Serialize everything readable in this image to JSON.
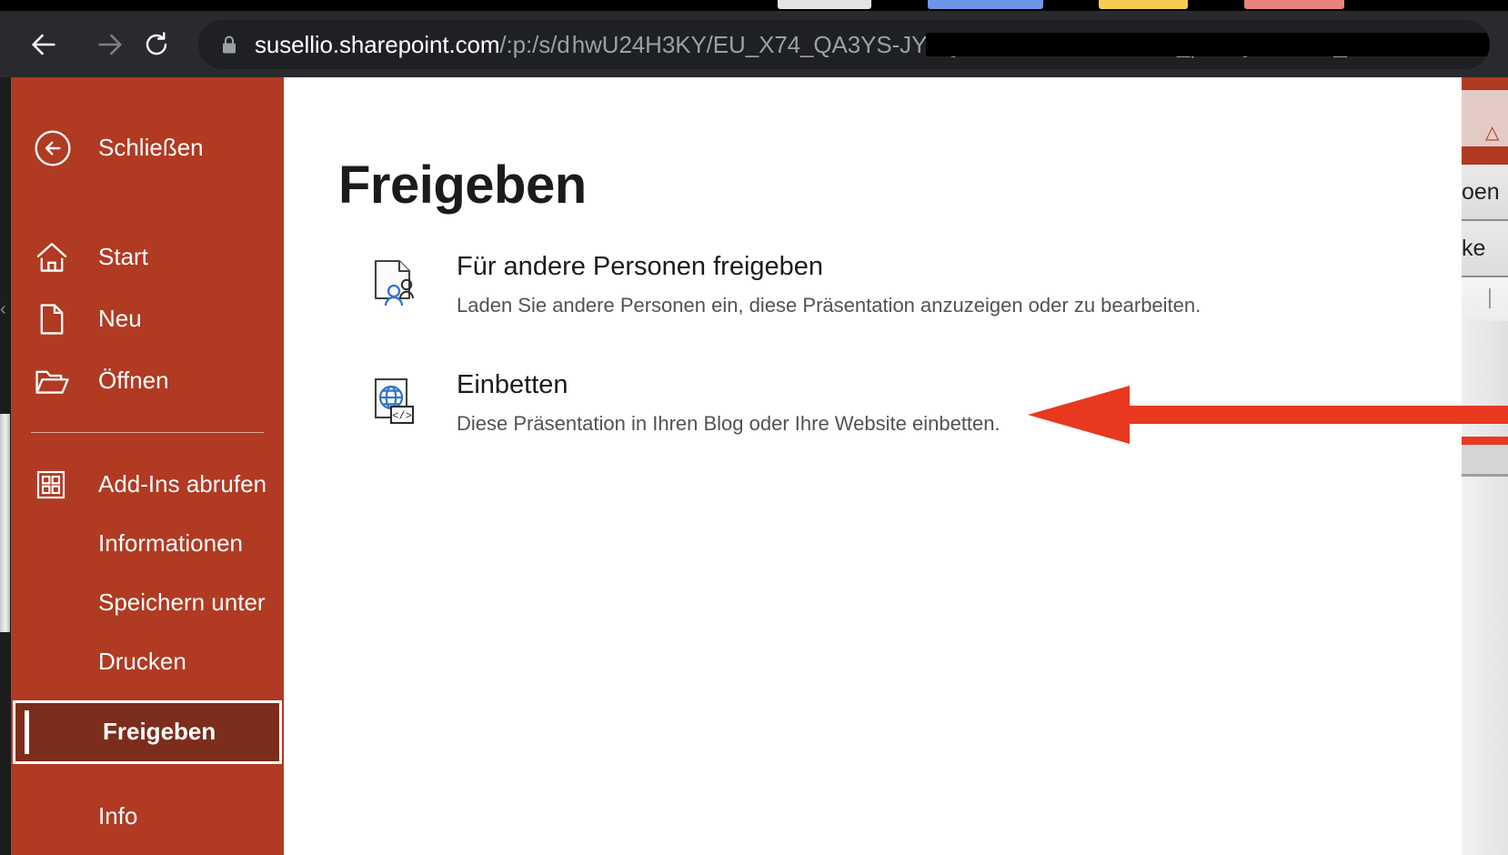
{
  "browser": {
    "back_icon": "back-arrow-icon",
    "forward_icon": "forward-arrow-icon",
    "reload_icon": "reload-icon",
    "lock_icon": "lock-icon",
    "url_host": "susellio.sharepoint.com",
    "url_path": "/:p:/s/d",
    "url_redacted_note": "",
    "tabs": [
      {
        "name": "tab-1",
        "color": "#e4e4e4"
      },
      {
        "name": "tab-2",
        "color": "#6f95e8"
      },
      {
        "name": "tab-3",
        "color": "#f5ce51"
      },
      {
        "name": "tab-4",
        "color": "#e9837c"
      }
    ]
  },
  "sidebar": {
    "background_color": "#b03a22",
    "selected_color": "#7c2d1c",
    "close": {
      "label": "Schließen",
      "icon": "back-circle-icon"
    },
    "items": [
      {
        "label": "Start",
        "icon": "home-icon"
      },
      {
        "label": "Neu",
        "icon": "new-document-icon"
      },
      {
        "label": "Öffnen",
        "icon": "open-folder-icon"
      },
      {
        "label": "Add-Ins abrufen",
        "icon": "addins-grid-icon"
      },
      {
        "label": "Informationen",
        "icon": ""
      },
      {
        "label": "Speichern unter",
        "icon": ""
      },
      {
        "label": "Drucken",
        "icon": ""
      },
      {
        "label": "Freigeben",
        "icon": ""
      },
      {
        "label": "Info",
        "icon": ""
      }
    ],
    "selected_label": "Freigeben"
  },
  "main": {
    "title": "Freigeben",
    "options": [
      {
        "title": "Für andere Personen freigeben",
        "description": "Laden Sie andere Personen ein, diese Präsentation anzuzeigen oder zu bearbeiten.",
        "icon": "share-with-people-icon"
      },
      {
        "title": "Einbetten",
        "description": "Diese Präsentation in Ihren Blog oder Ihre Website einbetten.",
        "icon": "embed-globe-code-icon"
      }
    ]
  },
  "annotation": {
    "arrow_color": "#e8381f",
    "arrow_icon": "left-pointing-arrow-icon",
    "points_to": "Einbetten"
  },
  "background_window": {
    "fragment_1": "oen",
    "fragment_2": "ke"
  }
}
